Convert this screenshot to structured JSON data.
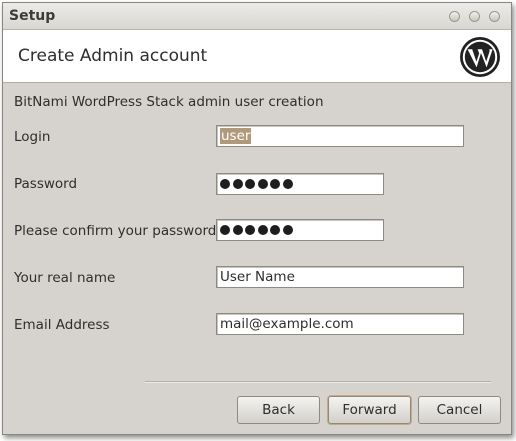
{
  "window": {
    "title": "Setup"
  },
  "header": {
    "title": "Create Admin account",
    "logo_icon": "wordpress-logo-icon"
  },
  "form": {
    "subtitle": "BitNami WordPress Stack admin user creation",
    "login": {
      "label": "Login",
      "value": "user"
    },
    "password": {
      "label": "Password",
      "masked_length": 6
    },
    "confirm_password": {
      "label": "Please confirm your password",
      "masked_length": 6
    },
    "real_name": {
      "label": "Your real name",
      "value": "User Name"
    },
    "email": {
      "label": "Email Address",
      "value": "mail@example.com"
    }
  },
  "buttons": {
    "back": "Back",
    "forward": "Forward",
    "cancel": "Cancel"
  },
  "colors": {
    "dialog_background": "#d6d3ce",
    "selection": "#b09a7c",
    "default_button_focus": "#c8a983"
  }
}
